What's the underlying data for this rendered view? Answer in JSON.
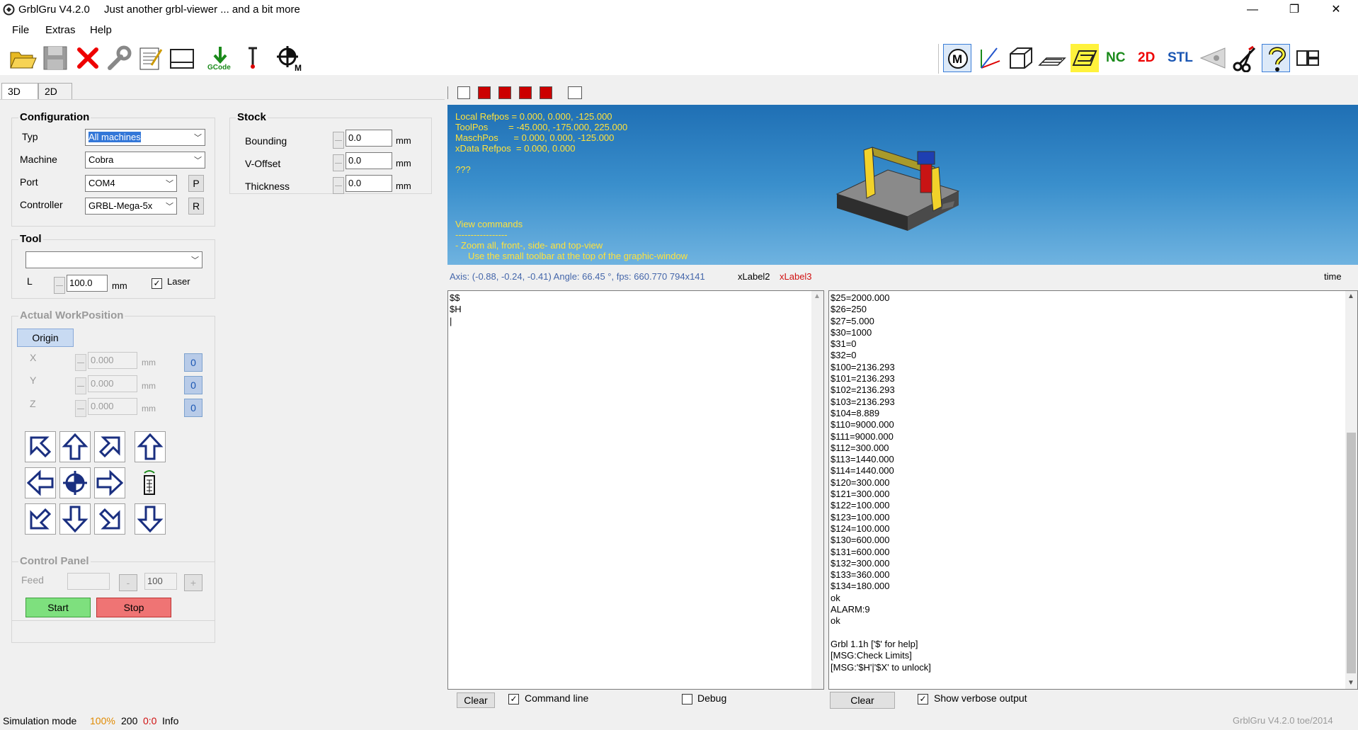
{
  "app": {
    "title": "GrblGru V4.2.0",
    "subtitle": "Just another grbl-viewer ... and a bit more"
  },
  "window_controls": {
    "minimize": "—",
    "restore": "❐",
    "close": "✕"
  },
  "menu": [
    "File",
    "Extras",
    "Help"
  ],
  "toolbar_left": [
    "open-folder-icon",
    "save-disk-icon",
    "close-x-icon",
    "wrench-settings-icon",
    "notepad-icon",
    "window-icon",
    "gcode-download-icon",
    "probe-icon",
    "crosshair-m-icon"
  ],
  "gcode_label": "GCode",
  "toolbar_right": {
    "m": "M",
    "nc": "NC",
    "twod": "2D",
    "stl": "STL"
  },
  "tabs": [
    "3D",
    "2D"
  ],
  "configuration": {
    "title": "Configuration",
    "typ_label": "Typ",
    "typ_value": "All machines",
    "machine_label": "Machine",
    "machine_value": "Cobra",
    "port_label": "Port",
    "port_value": "COM4",
    "port_btn": "P",
    "controller_label": "Controller",
    "controller_value": "GRBL-Mega-5x",
    "controller_btn": "R"
  },
  "stock": {
    "title": "Stock",
    "rows": [
      {
        "label": "Bounding",
        "value": "0.0",
        "unit": "mm"
      },
      {
        "label": "V-Offset",
        "value": "0.0",
        "unit": "mm"
      },
      {
        "label": "Thickness",
        "value": "0.0",
        "unit": "mm"
      }
    ]
  },
  "tool": {
    "title": "Tool",
    "select_value": "",
    "l_label": "L",
    "l_value": "100.0",
    "l_unit": "mm",
    "laser_label": "Laser",
    "laser_checked": true
  },
  "workpos": {
    "title": "Actual WorkPosition",
    "origin_btn": "Origin",
    "axes": [
      {
        "label": "X",
        "value": "0.000",
        "unit": "mm",
        "zero": "0"
      },
      {
        "label": "Y",
        "value": "0.000",
        "unit": "mm",
        "zero": "0"
      },
      {
        "label": "Z",
        "value": "0.000",
        "unit": "mm",
        "zero": "0"
      }
    ]
  },
  "control_panel": {
    "title": "Control Panel",
    "feed_label": "Feed",
    "feed_value": "",
    "minus": "-",
    "percent": "100",
    "plus": "+",
    "start": "Start",
    "stop": "Stop"
  },
  "view3d": {
    "info": "Local Refpos = 0.000, 0.000, -125.000\nToolPos        = -45.000, -175.000, 225.000\nMaschPos      = 0.000, 0.000, -125.000\nxData Refpos  = 0.000, 0.000",
    "qqq": "???",
    "commands": "View commands\n-----------------\n- Zoom all, front-, side- and top-view\n     Use the small toolbar at the top of the graphic-window"
  },
  "infoline": {
    "axis": "Axis: (-0.88, -0.24, -0.41) Angle: 66.45 °, fps: 660.770   794x141",
    "label2": "xLabel2",
    "label3": "xLabel3",
    "time": "time"
  },
  "log_left": "$$\n$H\n|",
  "log_right": "$25=2000.000\n$26=250\n$27=5.000\n$30=1000\n$31=0\n$32=0\n$100=2136.293\n$101=2136.293\n$102=2136.293\n$103=2136.293\n$104=8.889\n$110=9000.000\n$111=9000.000\n$112=300.000\n$113=1440.000\n$114=1440.000\n$120=300.000\n$121=300.000\n$122=100.000\n$123=100.000\n$124=100.000\n$130=600.000\n$131=600.000\n$132=300.000\n$133=360.000\n$134=180.000\nok\nALARM:9\nok\n\nGrbl 1.1h ['$' for help]\n[MSG:Check Limits]\n[MSG:'$H'|'$X' to unlock]",
  "bottom_left": {
    "clear": "Clear",
    "cmdline": "Command line",
    "cmdline_checked": true,
    "debug": "Debug",
    "debug_checked": false
  },
  "bottom_right": {
    "clear": "Clear",
    "verbose": "Show verbose output",
    "verbose_checked": true
  },
  "status": {
    "mode": "Simulation mode",
    "pct": "100%",
    "n200": "200",
    "ratio": "0:0",
    "info": "Info",
    "version": "GrblGru V4.2.0 toe/2014"
  }
}
